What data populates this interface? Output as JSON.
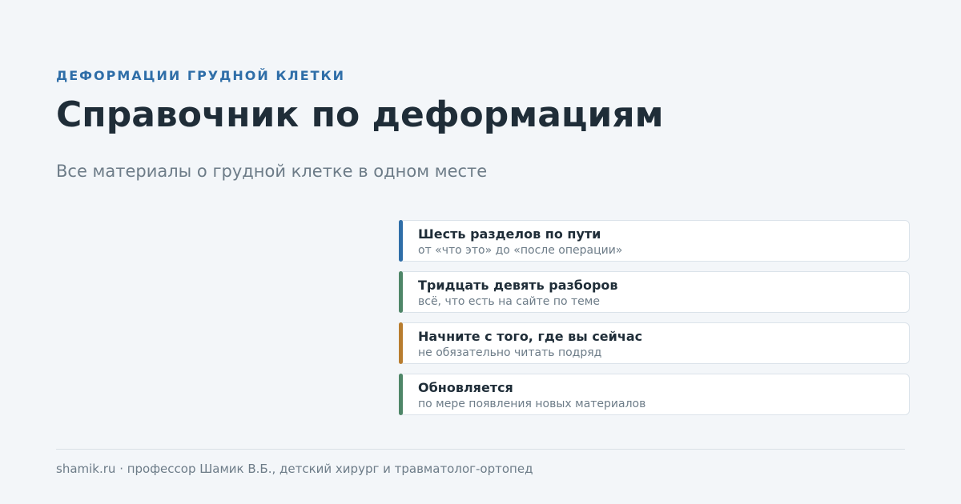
{
  "header": {
    "eyebrow": "ДЕФОРМАЦИИ ГРУДНОЙ КЛЕТКИ",
    "title": "Справочник по деформациям",
    "subtitle": "Все материалы о грудной клетке в одном месте"
  },
  "cards": [
    {
      "title": "Шесть разделов по пути",
      "desc": "от «что это» до «после операции»",
      "accent": "#2f6ea8"
    },
    {
      "title": "Тридцать девять разборов",
      "desc": "всё, что есть на сайте по теме",
      "accent": "#4e8668"
    },
    {
      "title": "Начните с того, где вы сейчас",
      "desc": "не обязательно читать подряд",
      "accent": "#b87d2f"
    },
    {
      "title": "Обновляется",
      "desc": "по мере появления новых материалов",
      "accent": "#4e8668"
    }
  ],
  "footer": {
    "text": "shamik.ru · профессор Шамик В.Б., детский хирург и травматолог-ортопед"
  }
}
